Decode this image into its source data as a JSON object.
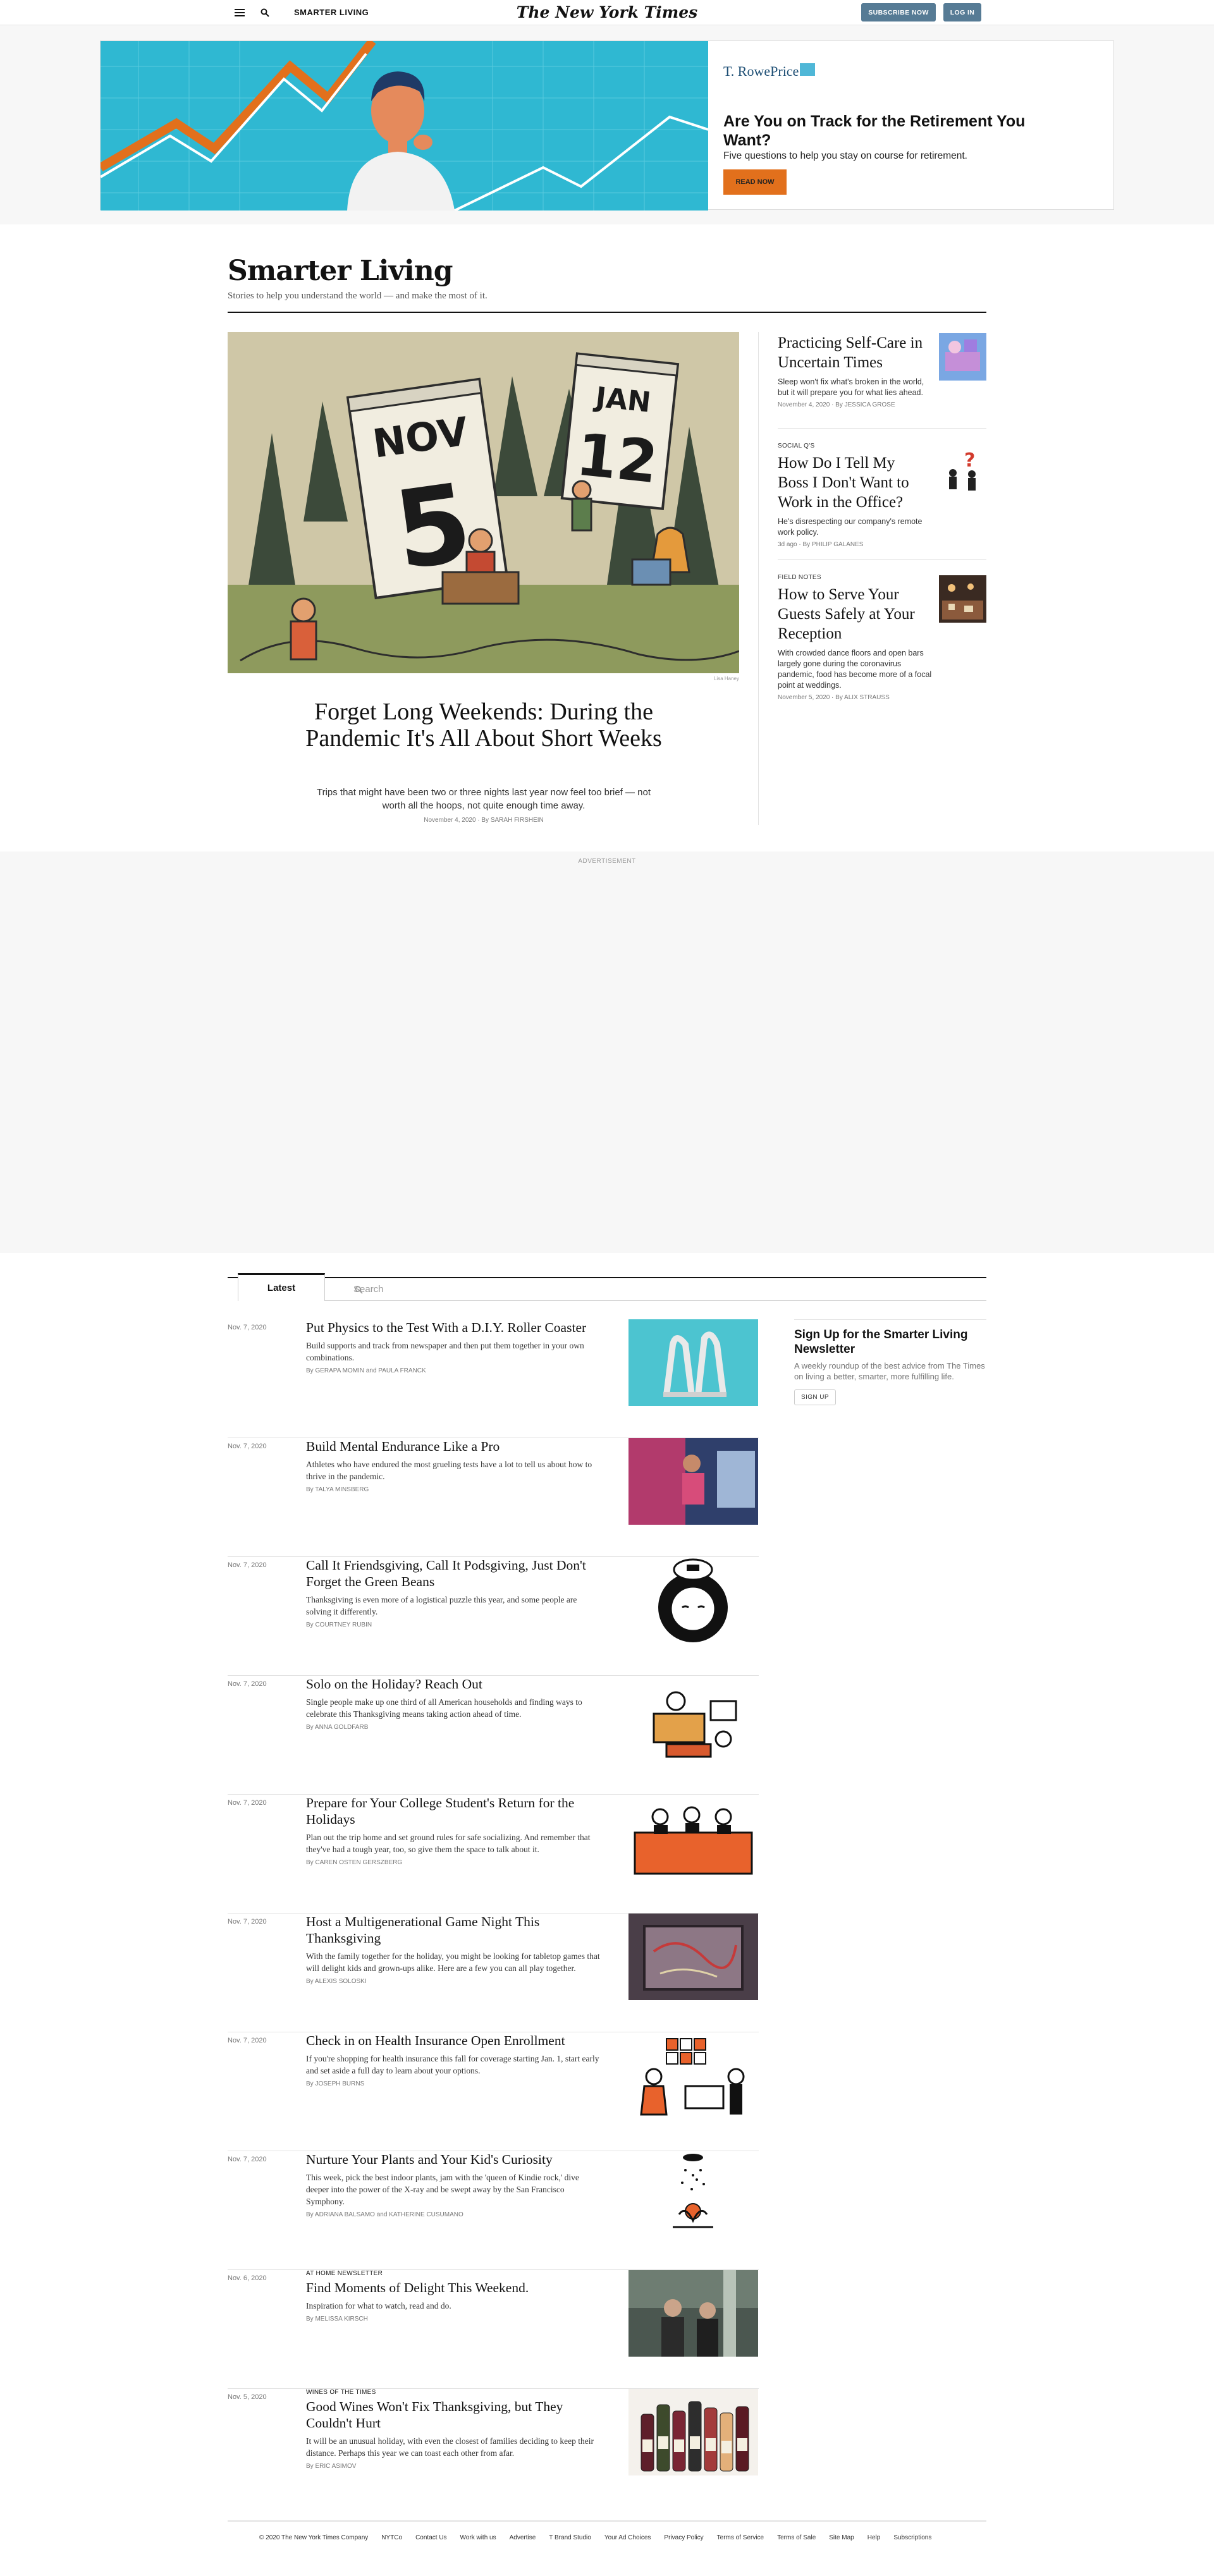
{
  "topbar": {
    "section_name": "SMARTER LIVING",
    "masthead": "The New York Times",
    "subscribe_label": "SUBSCRIBE NOW",
    "login_label": "LOG IN",
    "menu_icon": "hamburger-menu-icon",
    "search_icon": "search-icon"
  },
  "ad": {
    "brand": "T. RowePrice",
    "headline": "Are You on Track for the Retirement You Want?",
    "subtext": "Five questions to help you stay on course for retirement.",
    "cta": "READ NOW"
  },
  "header": {
    "title": "Smarter Living",
    "subtitle": "Stories to help you understand the world — and make the most of it."
  },
  "lead": {
    "calendar_left_month": "NOV",
    "calendar_left_day": "5",
    "calendar_right_month": "JAN",
    "calendar_right_day": "12",
    "credit": "Lisa Haney",
    "headline": "Forget Long Weekends: During the Pandemic It's All About Short Weeks",
    "summary": "Trips that might have been two or three nights last year now feel too brief — not worth all the hoops, not quite enough time away.",
    "meta": "November 4, 2020  ·  By SARAH FIRSHEIN"
  },
  "side_stories": [
    {
      "kicker": "",
      "headline": "Practicing Self-Care in Uncertain Times",
      "summary": "Sleep won't fix what's broken in the world, but it will prepare you for what lies ahead.",
      "meta": "November 4, 2020  ·  By JESSICA GROSE"
    },
    {
      "kicker": "SOCIAL Q'S",
      "headline": "How Do I Tell My Boss I Don't Want to Work in the Office?",
      "summary": "He's disrespecting our company's remote work policy.",
      "meta": "3d ago  ·  By PHILIP GALANES"
    },
    {
      "kicker": "FIELD NOTES",
      "headline": "How to Serve Your Guests Safely at Your Reception",
      "summary": "With crowded dance floors and open bars largely gone during the coronavirus pandemic, food has become more of a focal point at weddings.",
      "meta": "November 5, 2020  ·  By ALIX STRAUSS"
    }
  ],
  "advertisement_label": "ADVERTISEMENT",
  "tabs": {
    "latest": "Latest",
    "search_placeholder": "Search"
  },
  "stream": [
    {
      "date": "Nov. 7, 2020",
      "kicker": "",
      "headline": "Put Physics to the Test With a D.I.Y. Roller Coaster",
      "summary": "Build supports and track from newspaper and then put them together in your own combinations.",
      "byline": "By GERAPA MOMIN and PAULA FRANCK"
    },
    {
      "date": "Nov. 7, 2020",
      "kicker": "",
      "headline": "Build Mental Endurance Like a Pro",
      "summary": "Athletes who have endured the most grueling tests have a lot to tell us about how to thrive in the pandemic.",
      "byline": "By TALYA MINSBERG"
    },
    {
      "date": "Nov. 7, 2020",
      "kicker": "",
      "headline": "Call It Friendsgiving, Call It Podsgiving, Just Don't Forget the Green Beans",
      "summary": "Thanksgiving is even more of a logistical puzzle this year, and some people are solving it differently.",
      "byline": "By COURTNEY RUBIN"
    },
    {
      "date": "Nov. 7, 2020",
      "kicker": "",
      "headline": "Solo on the Holiday? Reach Out",
      "summary": "Single people make up one third of all American households and finding ways to celebrate this Thanksgiving means taking action ahead of time.",
      "byline": "By ANNA GOLDFARB"
    },
    {
      "date": "Nov. 7, 2020",
      "kicker": "",
      "headline": "Prepare for Your College Student's Return for the Holidays",
      "summary": "Plan out the trip home and set ground rules for safe socializing. And remember that they've had a tough year, too, so give them the space to talk about it.",
      "byline": "By CAREN OSTEN GERSZBERG"
    },
    {
      "date": "Nov. 7, 2020",
      "kicker": "",
      "headline": "Host a Multigenerational Game Night This Thanksgiving",
      "summary": "With the family together for the holiday, you might be looking for tabletop games that will delight kids and grown-ups alike. Here are a few you can all play together.",
      "byline": "By ALEXIS SOLOSKI"
    },
    {
      "date": "Nov. 7, 2020",
      "kicker": "",
      "headline": "Check in on Health Insurance Open Enrollment",
      "summary": "If you're shopping for health insurance this fall for coverage starting Jan. 1, start early and set aside a full day to learn about your options.",
      "byline": "By JOSEPH BURNS"
    },
    {
      "date": "Nov. 7, 2020",
      "kicker": "",
      "headline": "Nurture Your Plants and Your Kid's Curiosity",
      "summary": "This week, pick the best indoor plants, jam with the 'queen of Kindie rock,' dive deeper into the power of the X-ray and be swept away by the San Francisco Symphony.",
      "byline": "By ADRIANA BALSAMO and KATHERINE CUSUMANO"
    },
    {
      "date": "Nov. 6, 2020",
      "kicker": "AT HOME NEWSLETTER",
      "headline": "Find Moments of Delight This Weekend.",
      "summary": "Inspiration for what to watch, read and do.",
      "byline": "By MELISSA KIRSCH"
    },
    {
      "date": "Nov. 5, 2020",
      "kicker": "WINES OF THE TIMES",
      "headline": "Good Wines Won't Fix Thanksgiving, but They Couldn't Hurt",
      "summary": "It will be an unusual holiday, with even the closest of families deciding to keep their distance. Perhaps this year we can toast each other from afar.",
      "byline": "By ERIC ASIMOV"
    }
  ],
  "newsletter": {
    "title": "Sign Up for the Smarter Living Newsletter",
    "description": "A weekly roundup of the best advice from The Times on living a better, smarter, more fulfilling life.",
    "button": "SIGN UP"
  },
  "footer": [
    "© 2020 The New York Times Company",
    "NYTCo",
    "Contact Us",
    "Work with us",
    "Advertise",
    "T Brand Studio",
    "Your Ad Choices",
    "Privacy Policy",
    "Terms of Service",
    "Terms of Sale",
    "Site Map",
    "Help",
    "Subscriptions"
  ]
}
